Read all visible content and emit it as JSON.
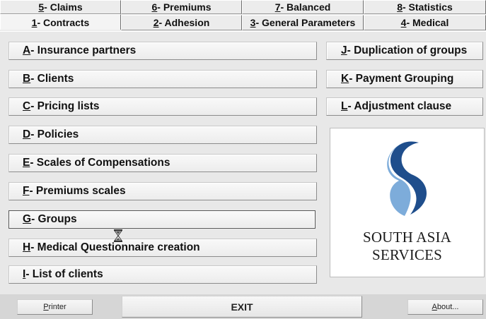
{
  "tabs_back": [
    {
      "key": "5",
      "label": " - Claims"
    },
    {
      "key": "6",
      "label": " - Premiums"
    },
    {
      "key": "7",
      "label": " - Balanced"
    },
    {
      "key": "8",
      "label": " - Statistics"
    }
  ],
  "tabs_front": [
    {
      "key": "1",
      "label": " - Contracts"
    },
    {
      "key": "2",
      "label": " - Adhesion"
    },
    {
      "key": "3",
      "label": " - General Parameters"
    },
    {
      "key": "4",
      "label": " - Medical"
    }
  ],
  "left_buttons": [
    {
      "key": "A",
      "label": " - Insurance partners"
    },
    {
      "key": "B",
      "label": " - Clients"
    },
    {
      "key": "C",
      "label": " - Pricing lists"
    },
    {
      "key": "D",
      "label": " - Policies"
    },
    {
      "key": "E",
      "label": " - Scales of Compensations"
    },
    {
      "key": "F",
      "label": " - Premiums scales"
    },
    {
      "key": "G",
      "label": " - Groups"
    },
    {
      "key": "H",
      "label": " - Medical Questionnaire creation"
    },
    {
      "key": "I",
      "label": " - List of clients"
    }
  ],
  "right_buttons": [
    {
      "key": "J",
      "label": " - Duplication of groups"
    },
    {
      "key": "K",
      "label": " - Payment Grouping"
    },
    {
      "key": "L",
      "label": " - Adjustment clause"
    }
  ],
  "logo": {
    "text": "SOUTH ASIA SERVICES",
    "color_dark": "#1f4e8c",
    "color_light": "#6fa3d6"
  },
  "footer": {
    "printer": {
      "key": "P",
      "label": "rinter"
    },
    "exit": "EXIT",
    "about": {
      "key": "A",
      "label": "bout..."
    }
  }
}
